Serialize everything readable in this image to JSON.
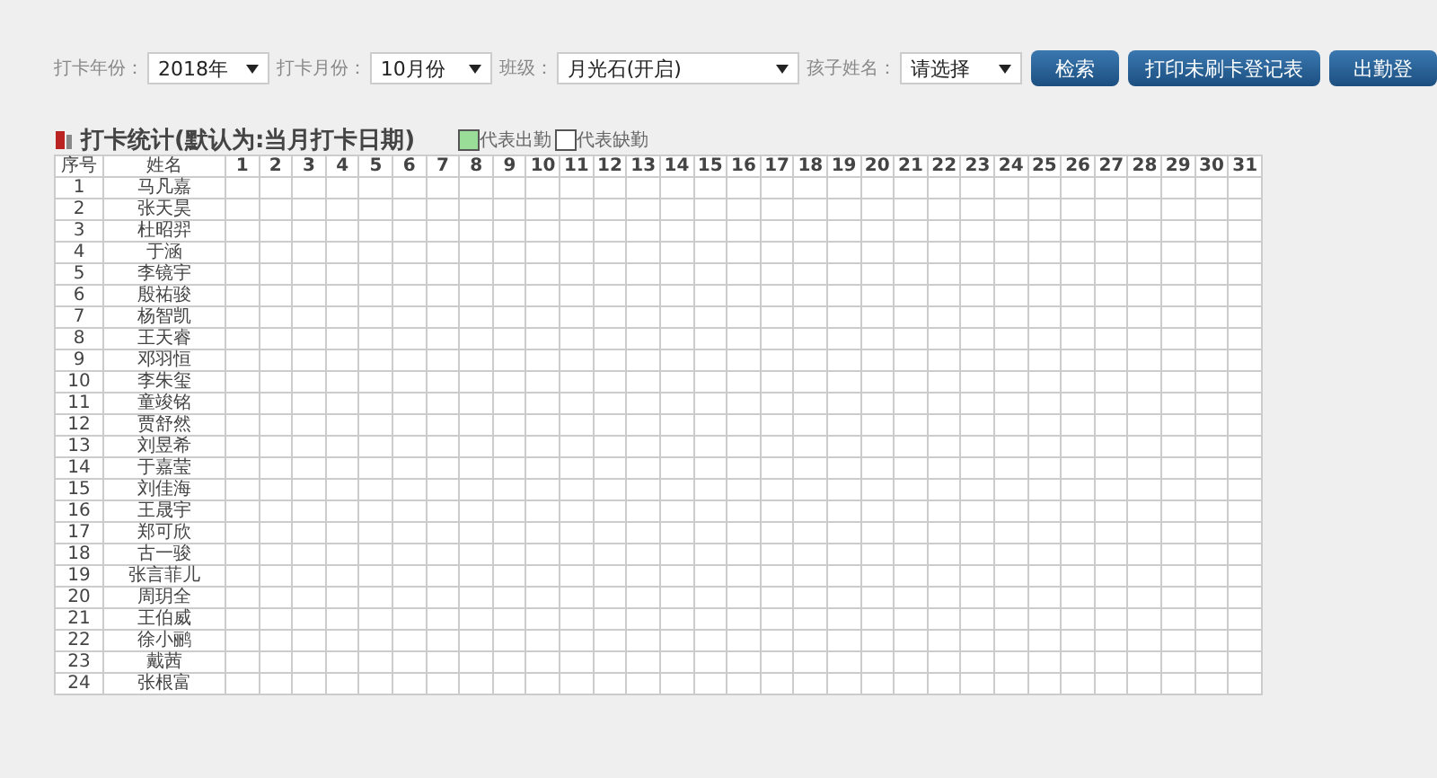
{
  "filters": [
    {
      "label": "打卡年份：",
      "value": "2018年",
      "kind": "short"
    },
    {
      "label": "打卡月份：",
      "value": "10月份",
      "kind": "short"
    },
    {
      "label": "班级：",
      "value": "月光石(开启)",
      "kind": "wide"
    },
    {
      "label": "孩子姓名：",
      "value": "请选择",
      "kind": "short"
    }
  ],
  "buttons": [
    "检索",
    "打印未刷卡登记表",
    "出勤登"
  ],
  "section": {
    "title": "打卡统计(默认为:当月打卡日期)"
  },
  "legend": [
    {
      "label": "代表出勤",
      "color": "#99dd99"
    },
    {
      "label": "代表缺勤",
      "color": "#ffffff"
    }
  ],
  "table": {
    "columns": [
      "序号",
      "姓名",
      "1",
      "2",
      "3",
      "4",
      "5",
      "6",
      "7",
      "8",
      "9",
      "10",
      "11",
      "12",
      "13",
      "14",
      "15",
      "16",
      "17",
      "18",
      "19",
      "20",
      "21",
      "22",
      "23",
      "24",
      "25",
      "26",
      "27",
      "28",
      "29",
      "30",
      "31"
    ],
    "rows": [
      [
        "1",
        "马凡嘉"
      ],
      [
        "2",
        "张天昊"
      ],
      [
        "3",
        "杜昭羿"
      ],
      [
        "4",
        "于涵"
      ],
      [
        "5",
        "李镜宇"
      ],
      [
        "6",
        "殷祐骏"
      ],
      [
        "7",
        "杨智凯"
      ],
      [
        "8",
        "王天睿"
      ],
      [
        "9",
        "邓羽恒"
      ],
      [
        "10",
        "李朱玺"
      ],
      [
        "11",
        "童竣铭"
      ],
      [
        "12",
        "贾舒然"
      ],
      [
        "13",
        "刘昱希"
      ],
      [
        "14",
        "于嘉莹"
      ],
      [
        "15",
        "刘佳海"
      ],
      [
        "16",
        "王晟宇"
      ],
      [
        "17",
        "郑可欣"
      ],
      [
        "18",
        "古一骏"
      ],
      [
        "19",
        "张言菲儿"
      ],
      [
        "20",
        "周玥全"
      ],
      [
        "21",
        "王伯威"
      ],
      [
        "22",
        "徐小鹂"
      ],
      [
        "23",
        "戴茜"
      ],
      [
        "24",
        "张根富"
      ]
    ]
  }
}
